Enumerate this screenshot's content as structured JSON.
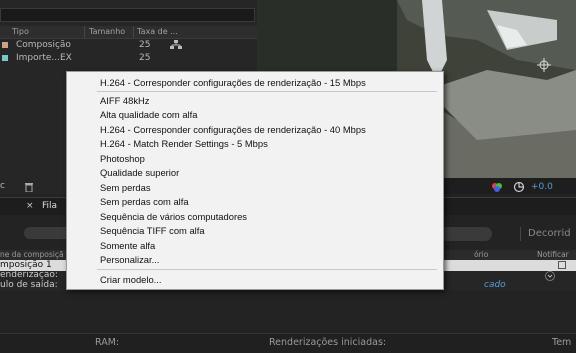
{
  "project_panel": {
    "columns": {
      "type": "Tipo",
      "size": "Tamanho",
      "rate": "Taxa de ..."
    },
    "items": [
      {
        "name": "Composição",
        "rate": "25",
        "swatch": "#c9a48a",
        "icon": "flowchart-icon"
      },
      {
        "name": "Importe...EX",
        "rate": "25",
        "swatch": "#79c7c7"
      }
    ],
    "toolbar_left": "c"
  },
  "preview": {
    "overlay_value": "+0.0"
  },
  "render_queue": {
    "tab_label": "Fila",
    "right_button": "Decorrid",
    "columns": {
      "comp_name": "ne da composiçã",
      "log": "ório",
      "notify": "Notificar"
    },
    "row_composition": "mposição 1",
    "row_render_settings": "enderização:",
    "row_output_module": "ulo de saída:",
    "row_output_link": "cado",
    "status": {
      "ram": "RAM:",
      "renders_started": "Renderizações iniciadas:",
      "total": "Tem"
    }
  },
  "context_menu": {
    "items": [
      "H.264 - Corresponder configurações de renderização - 15 Mbps",
      "AIFF 48kHz",
      "Alta qualidade com alfa",
      "H.264 - Corresponder configurações de renderização - 40 Mbps",
      "H.264 - Match Render Settings -  5 Mbps",
      "Photoshop",
      "Qualidade superior",
      "Sem perdas",
      "Sem perdas com alfa",
      "Sequência de vários computadores",
      "Sequência TIFF com alfa",
      "Somente alfa",
      "Personalizar...",
      "Criar modelo..."
    ]
  },
  "colors": {
    "menu_bg": "#f2f2f2",
    "panel_bg": "#232323",
    "accent_link": "#5b9bd5"
  }
}
